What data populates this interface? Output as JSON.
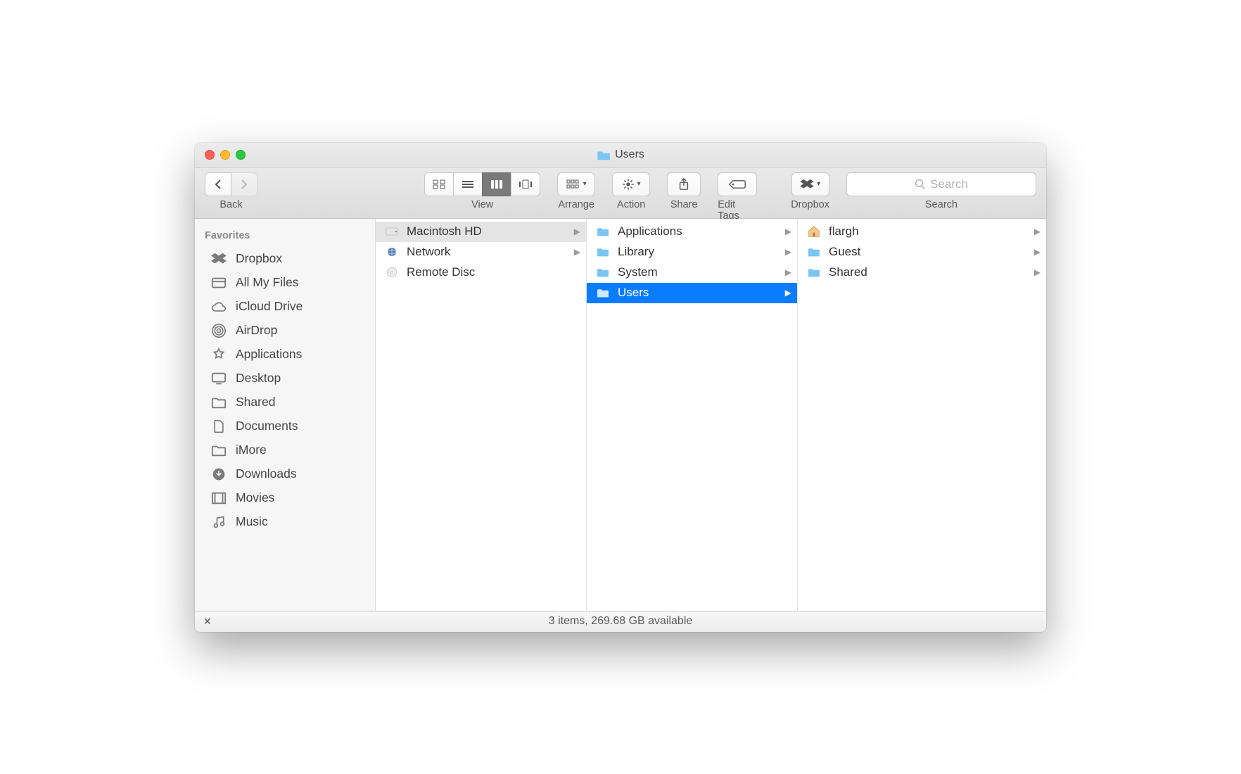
{
  "window": {
    "title": "Users"
  },
  "toolbar": {
    "back_label": "Back",
    "view_label": "View",
    "arrange_label": "Arrange",
    "action_label": "Action",
    "share_label": "Share",
    "edit_tags_label": "Edit Tags",
    "dropbox_label": "Dropbox",
    "search_label_below": "Search",
    "search_placeholder": "Search"
  },
  "sidebar": {
    "heading": "Favorites",
    "items": [
      {
        "label": "Dropbox",
        "icon": "dropbox-icon"
      },
      {
        "label": "All My Files",
        "icon": "all-my-files-icon"
      },
      {
        "label": "iCloud Drive",
        "icon": "cloud-icon"
      },
      {
        "label": "AirDrop",
        "icon": "airdrop-icon"
      },
      {
        "label": "Applications",
        "icon": "applications-icon"
      },
      {
        "label": "Desktop",
        "icon": "desktop-icon"
      },
      {
        "label": "Shared",
        "icon": "folder-icon"
      },
      {
        "label": "Documents",
        "icon": "documents-icon"
      },
      {
        "label": "iMore",
        "icon": "folder-icon"
      },
      {
        "label": "Downloads",
        "icon": "downloads-icon"
      },
      {
        "label": "Movies",
        "icon": "movies-icon"
      },
      {
        "label": "Music",
        "icon": "music-icon"
      }
    ]
  },
  "columns": [
    {
      "items": [
        {
          "label": "Macintosh HD",
          "icon": "hdd-icon",
          "selected": true,
          "has_children": true
        },
        {
          "label": "Network",
          "icon": "network-icon",
          "has_children": true
        },
        {
          "label": "Remote Disc",
          "icon": "disc-icon",
          "has_children": false
        }
      ]
    },
    {
      "items": [
        {
          "label": "Applications",
          "icon": "folder-blue-icon",
          "has_children": true
        },
        {
          "label": "Library",
          "icon": "folder-blue-icon",
          "has_children": true
        },
        {
          "label": "System",
          "icon": "folder-blue-icon",
          "has_children": true
        },
        {
          "label": "Users",
          "icon": "folder-blue-icon",
          "has_children": true,
          "highlight": true
        }
      ]
    },
    {
      "items": [
        {
          "label": "flargh",
          "icon": "home-icon",
          "has_children": true
        },
        {
          "label": "Guest",
          "icon": "folder-blue-icon",
          "has_children": true
        },
        {
          "label": "Shared",
          "icon": "folder-blue-icon",
          "has_children": true
        }
      ]
    }
  ],
  "status": {
    "text": "3 items, 269.68 GB available"
  }
}
